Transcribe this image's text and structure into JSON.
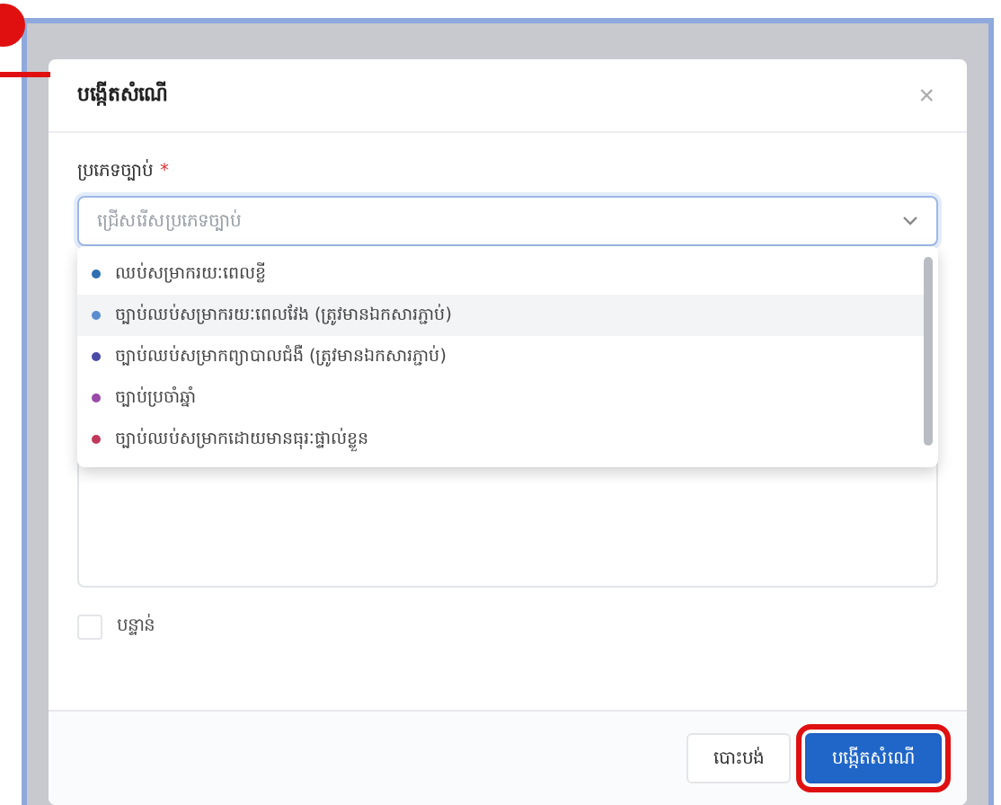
{
  "dialog": {
    "title": "បង្កើតសំណើ",
    "close": "×"
  },
  "leave_type": {
    "label": "ប្រភេទច្បាប់",
    "required_mark": "*",
    "placeholder": "ជ្រើសរើសប្រភេទច្បាប់",
    "expanded": true,
    "options": [
      {
        "label": "ឈប់សម្រាករយៈពេលខ្លី",
        "color": "#2f6fb0",
        "selected": false
      },
      {
        "label": "ច្បាប់ឈប់សម្រាករយៈពេលវែង (ត្រូវមានឯកសារភ្ជាប់)",
        "color": "#5a8ed0",
        "selected": true
      },
      {
        "label": "ច្បាប់ឈប់សម្រាកព្យាបាលជំងឺ (ត្រូវមានឯកសារភ្ជាប់)",
        "color": "#4a4aa8",
        "selected": false
      },
      {
        "label": "ច្បាប់ប្រចាំឆ្នាំ",
        "color": "#9a4aa8",
        "selected": false
      },
      {
        "label": "ច្បាប់ឈប់សម្រាកដោយមានធុរៈផ្ទាល់ខ្លួន",
        "color": "#c0395a",
        "selected": false
      }
    ]
  },
  "urgent": {
    "label": "បន្ទាន់",
    "checked": false
  },
  "buttons": [
    {
      "label": "បោះបង់",
      "kind": "secondary"
    },
    {
      "label": "បង្កើតសំណើ",
      "kind": "primary"
    }
  ]
}
